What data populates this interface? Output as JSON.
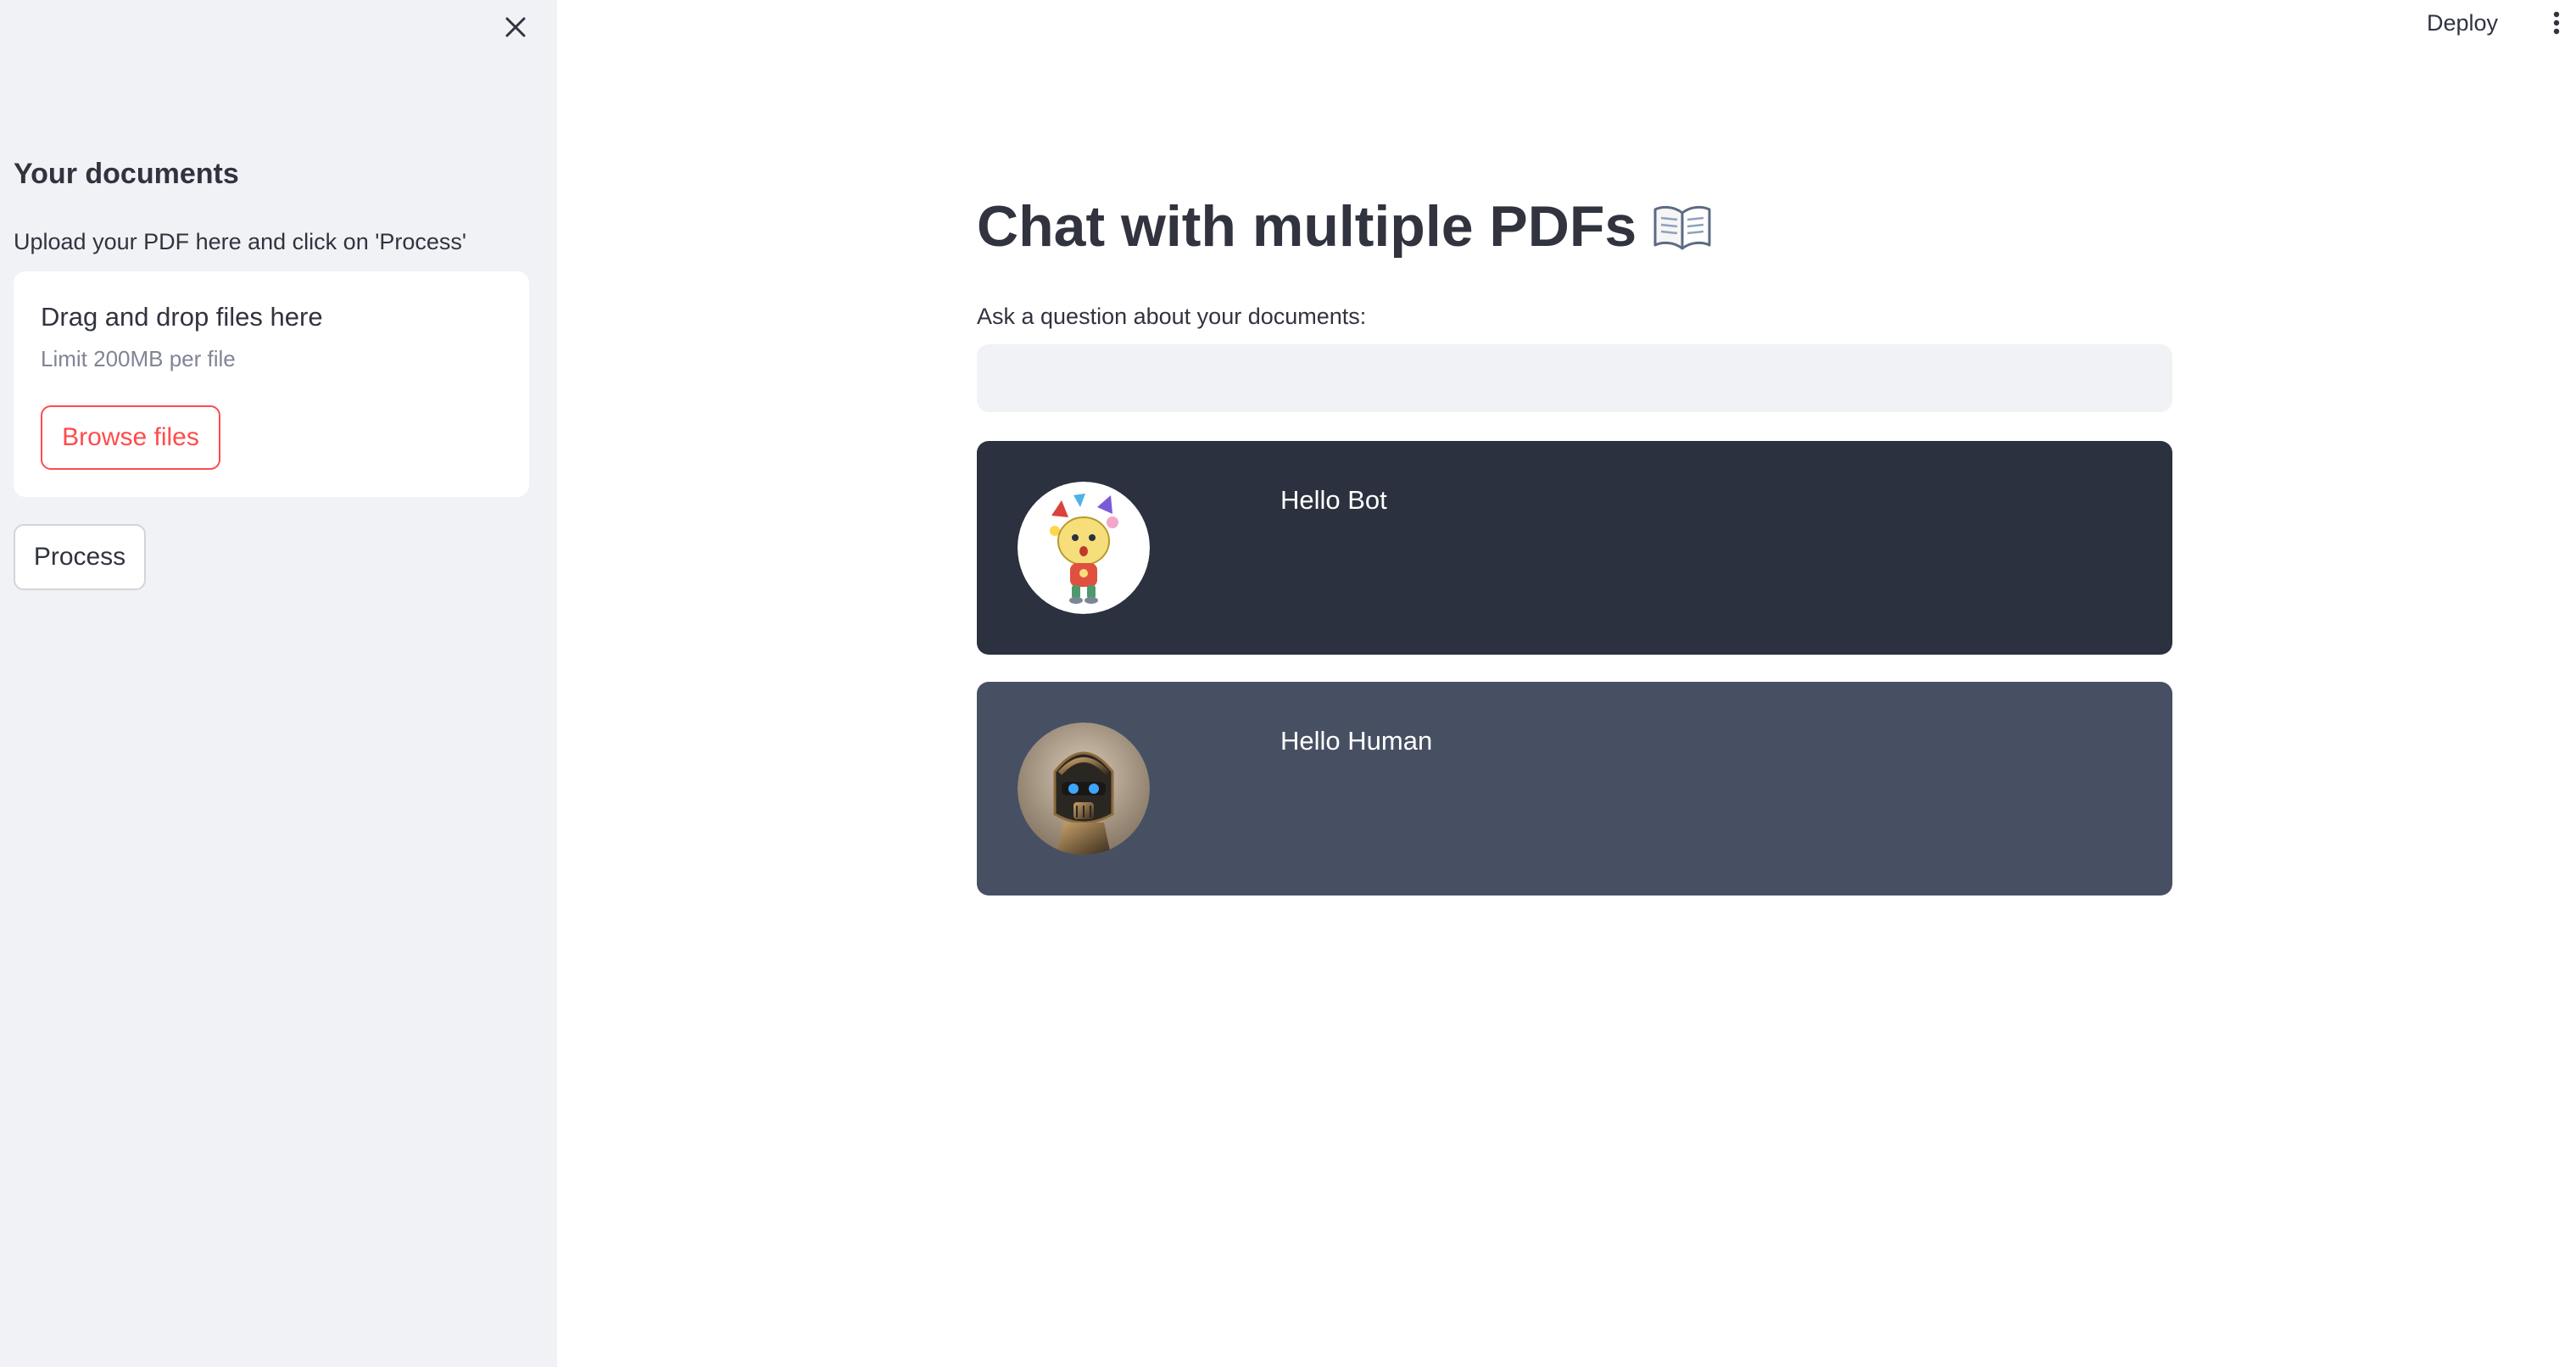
{
  "sidebar": {
    "heading": "Your documents",
    "upload_label": "Upload your PDF here and click on 'Process'",
    "dropzone": {
      "title": "Drag and drop files here",
      "limit": "Limit 200MB per file",
      "browse_label": "Browse files"
    },
    "process_label": "Process",
    "close_icon": "close-icon"
  },
  "header": {
    "deploy_label": "Deploy",
    "menu_icon": "more-vertical-icon"
  },
  "main": {
    "title": "Chat with multiple PDFs",
    "title_icon": "open-book-icon",
    "question_label": "Ask a question about your documents:",
    "question_value": "",
    "messages": [
      {
        "role": "bot",
        "text": "Hello Bot",
        "avatar": "cartoon-character-avatar"
      },
      {
        "role": "human",
        "text": "Hello Human",
        "avatar": "robot-avatar"
      }
    ]
  },
  "colors": {
    "accent": "#ff4b4b",
    "sidebar_bg": "#f0f2f6",
    "bot_message_bg": "#2b313e",
    "human_message_bg": "#475063",
    "text": "#31333f"
  }
}
